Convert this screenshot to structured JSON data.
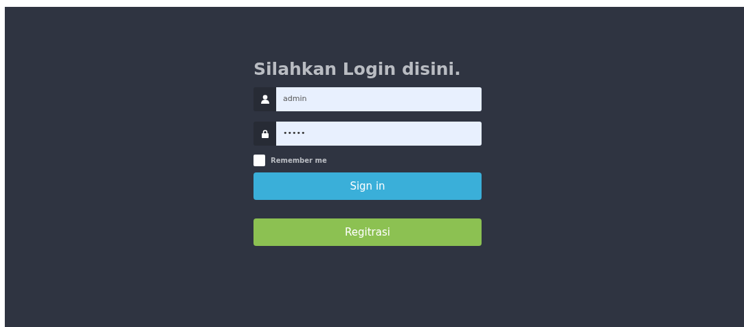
{
  "heading": "Silahkan Login disini.",
  "username": {
    "value": "admin"
  },
  "password": {
    "value": "•••••"
  },
  "remember": {
    "label": "Remember me",
    "checked": false
  },
  "buttons": [
    {
      "label": "Sign in",
      "kind": "primary"
    },
    {
      "label": "Regitrasi",
      "kind": "success"
    }
  ]
}
